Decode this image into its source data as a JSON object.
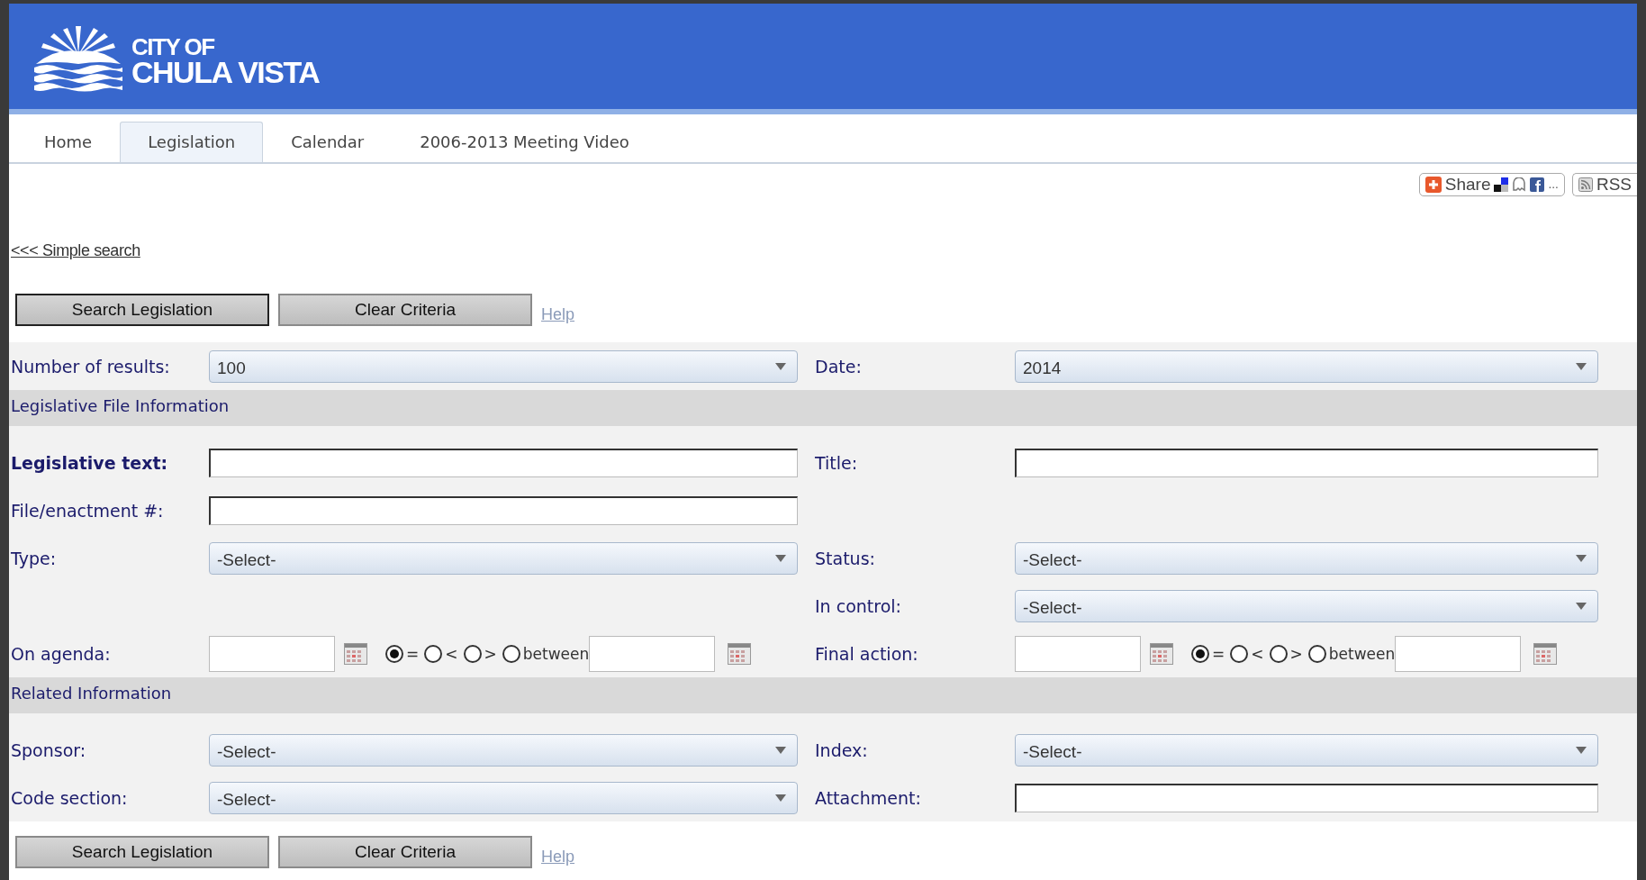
{
  "header": {
    "logo_line1": "CITY OF",
    "logo_line2": "CHULA VISTA"
  },
  "tabs": [
    {
      "label": "Home",
      "selected": false
    },
    {
      "label": "Legislation",
      "selected": true
    },
    {
      "label": "Calendar",
      "selected": false
    },
    {
      "label": "2006-2013 Meeting Video",
      "selected": false
    }
  ],
  "share": {
    "label": "Share",
    "more": "...",
    "rss": "RSS"
  },
  "simple_search_link": "<<< Simple search",
  "top_actions": {
    "search": "Search Legislation",
    "clear": "Clear Criteria",
    "help": "Help"
  },
  "form": {
    "rows": [
      {
        "kind": "fields",
        "left": {
          "label": "Number of results:",
          "kind": "select",
          "value": "100"
        },
        "right": {
          "label": "Date:",
          "kind": "select",
          "value": "2014"
        }
      },
      {
        "kind": "section",
        "title": "Legislative File Information"
      },
      {
        "kind": "fields",
        "left": {
          "label": "Legislative text:",
          "bold": true,
          "kind": "text"
        },
        "right": {
          "label": "Title:",
          "kind": "text"
        }
      },
      {
        "kind": "fields",
        "left": {
          "label": "File/enactment #:",
          "kind": "text"
        }
      },
      {
        "kind": "fields",
        "left": {
          "label": "Type:",
          "kind": "select",
          "value": "-Select-"
        },
        "right": {
          "label": "Status:",
          "kind": "select",
          "value": "-Select-"
        }
      },
      {
        "kind": "fields",
        "right": {
          "label": "In control:",
          "kind": "select",
          "value": "-Select-"
        }
      },
      {
        "kind": "fields",
        "left": {
          "label": "On agenda:",
          "kind": "date",
          "options": [
            {
              "label": "=",
              "selected": true
            },
            {
              "label": "<",
              "selected": false
            },
            {
              "label": ">",
              "selected": false
            },
            {
              "label": "between",
              "selected": false
            }
          ]
        },
        "right": {
          "label": "Final action:",
          "kind": "date",
          "options": [
            {
              "label": "=",
              "selected": true
            },
            {
              "label": "<",
              "selected": false
            },
            {
              "label": ">",
              "selected": false
            },
            {
              "label": "between",
              "selected": false
            }
          ]
        }
      },
      {
        "kind": "section",
        "title": "Related Information"
      },
      {
        "kind": "fields",
        "left": {
          "label": "Sponsor:",
          "kind": "select",
          "value": "-Select-"
        },
        "right": {
          "label": "Index:",
          "kind": "select",
          "value": "-Select-"
        }
      },
      {
        "kind": "fields",
        "left": {
          "label": "Code section:",
          "kind": "select",
          "value": "-Select-"
        },
        "right": {
          "label": "Attachment:",
          "kind": "text"
        }
      }
    ]
  },
  "bottom_actions": {
    "search": "Search Legislation",
    "clear": "Clear Criteria",
    "help": "Help"
  }
}
